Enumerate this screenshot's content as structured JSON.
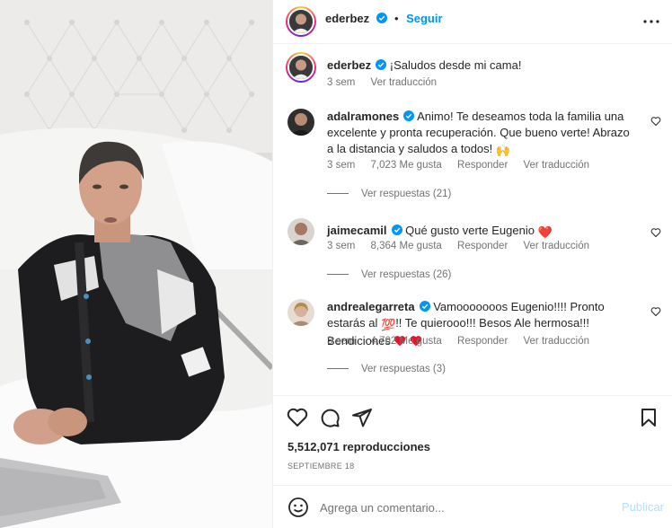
{
  "header": {
    "username": "ederbez",
    "separator": "•",
    "follow_label": "Seguir",
    "more_icon": "more-horizontal-icon"
  },
  "caption": {
    "username": "ederbez",
    "text": "¡Saludos desde mi cama!",
    "time": "3 sem",
    "translate": "Ver traducción"
  },
  "comments": [
    {
      "username": "adalramones",
      "text": "Animo! Te deseamos toda la familia una excelente y pronta recuperación. Que bueno verte! Abrazo a la distancia y saludos a todos!",
      "emoji": "🙌",
      "time": "3 sem",
      "likes": "7,023 Me gusta",
      "reply": "Responder",
      "translate": "Ver traducción",
      "replies": "Ver respuestas (21)"
    },
    {
      "username": "jaimecamil",
      "text": "Qué gusto verte Eugenio",
      "emoji": "❤️",
      "time": "3 sem",
      "likes": "8,364 Me gusta",
      "reply": "Responder",
      "translate": "Ver traducción",
      "replies": "Ver respuestas (26)"
    },
    {
      "username": "andrealegarreta",
      "text_part1": "Vamooooooos Eugenio!!!! Pronto estarás al",
      "emoji_mid": "💯",
      "text_part2": "!! Te quierooo!!! Besos Ale hermosa!!! Bendiciones",
      "time": "3 sem",
      "likes": "4,702 Me gusta",
      "reply": "Responder",
      "translate": "Ver traducción",
      "replies": "Ver respuestas (3)"
    }
  ],
  "stats": {
    "views": "5,512,071 reproducciones",
    "date": "SEPTIEMBRE 18"
  },
  "composer": {
    "placeholder": "Agrega un comentario...",
    "publish_label": "Publicar"
  },
  "colors": {
    "accent": "#0095f6",
    "publish_disabled": "#b2dffc",
    "heart_red": "#e0182d",
    "muted_text": "#737373"
  }
}
